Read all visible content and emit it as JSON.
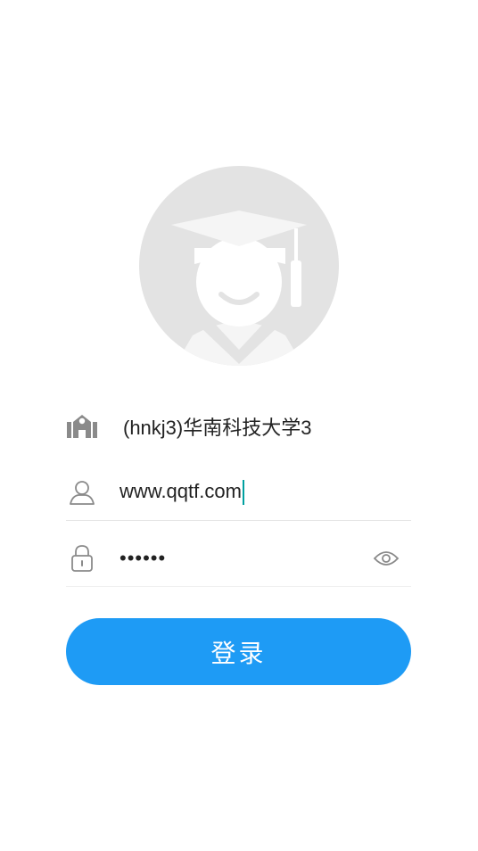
{
  "avatar": {
    "icon": "graduate-avatar-icon"
  },
  "school": {
    "icon": "school-building-icon",
    "name": "(hnkj3)华南科技大学3"
  },
  "account": {
    "icon": "user-icon",
    "value": "www.qqtf.com"
  },
  "password": {
    "icon": "lock-icon",
    "masked_value": "••••••",
    "toggle_icon": "eye-icon"
  },
  "login_button": {
    "label": "登录"
  },
  "colors": {
    "accent": "#1e9bf5",
    "icon_gray": "#8a8a8a",
    "cursor": "#00a0a0"
  }
}
